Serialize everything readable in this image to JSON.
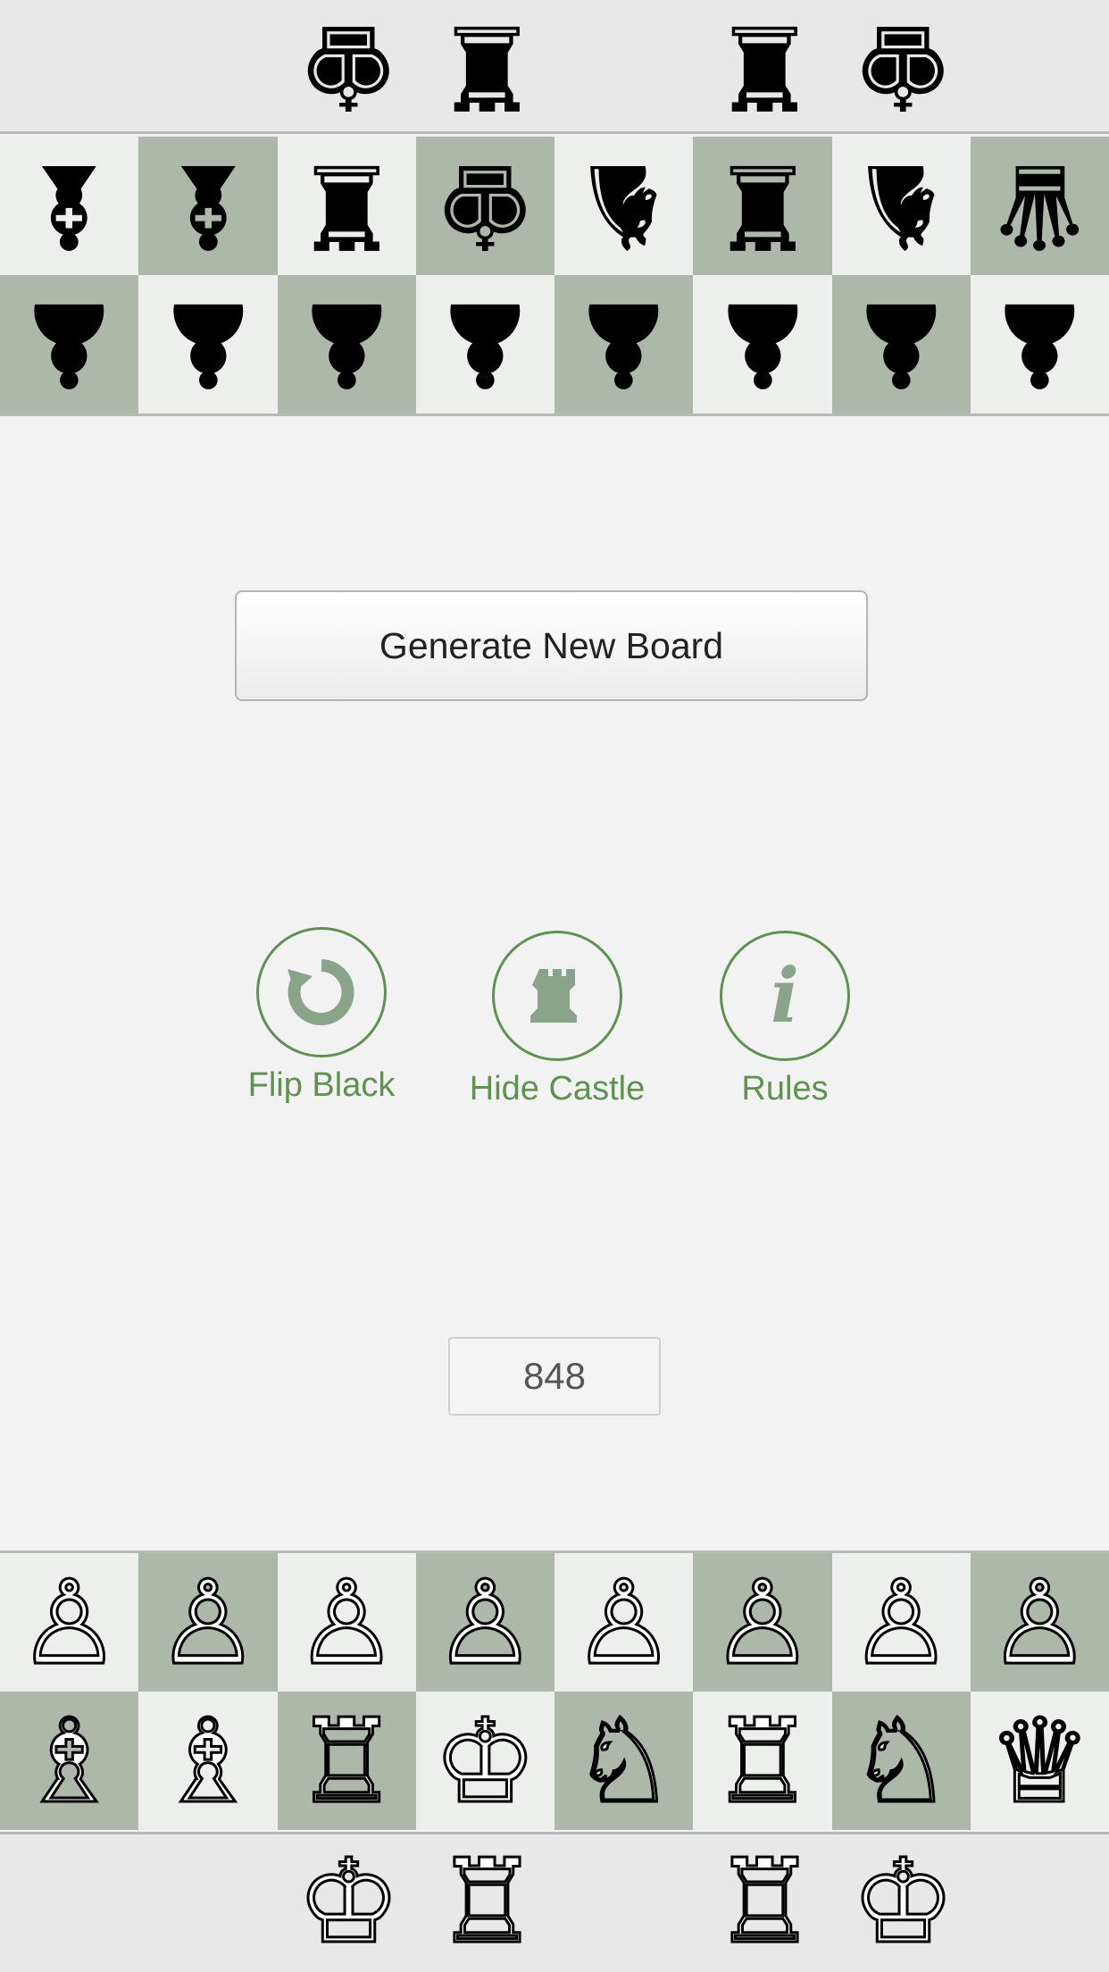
{
  "generate_button": "Generate New Board",
  "controls": [
    {
      "label": "Flip Black",
      "icon": "rotate-icon"
    },
    {
      "label": "Hide Castle",
      "icon": "castle-icon"
    },
    {
      "label": "Rules",
      "icon": "info-icon"
    }
  ],
  "board_number": "848",
  "colors": {
    "accent": "#5f9150",
    "light_square": "#edefec",
    "dark_square": "#adb8ab"
  },
  "black_reserve": [
    "king",
    "rook",
    "rook",
    "king"
  ],
  "black_back_rank": [
    "bishop",
    "bishop",
    "rook",
    "king",
    "knight",
    "rook",
    "knight",
    "queen"
  ],
  "black_pawns": [
    "pawn",
    "pawn",
    "pawn",
    "pawn",
    "pawn",
    "pawn",
    "pawn",
    "pawn"
  ],
  "white_pawns": [
    "pawn",
    "pawn",
    "pawn",
    "pawn",
    "pawn",
    "pawn",
    "pawn",
    "pawn"
  ],
  "white_back_rank": [
    "bishop",
    "bishop",
    "rook",
    "king",
    "knight",
    "rook",
    "knight",
    "queen"
  ],
  "white_reserve": [
    "king",
    "rook",
    "rook",
    "king"
  ]
}
